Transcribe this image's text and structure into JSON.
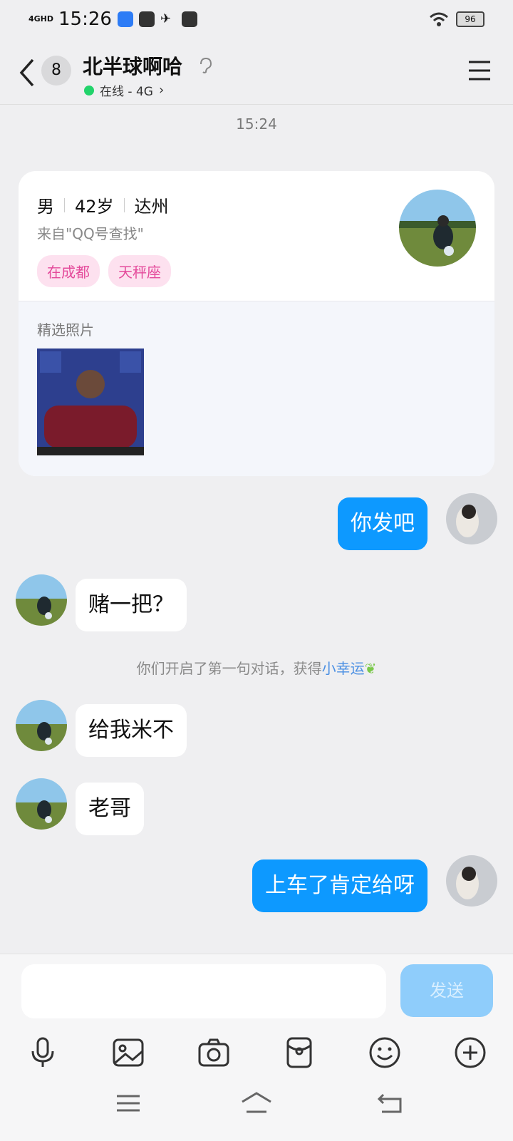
{
  "status_bar": {
    "network": "4GHD",
    "time": "15:26",
    "battery": "96"
  },
  "header": {
    "back_count": "8",
    "title": "北半球啊哈",
    "status": "在线 - 4G"
  },
  "chat_time": "15:24",
  "profile_card": {
    "gender": "男",
    "age": "42岁",
    "city": "达州",
    "source": "来自\"QQ号查找\"",
    "tags": [
      "在成都",
      "天秤座"
    ],
    "photos_label": "精选照片"
  },
  "messages": [
    {
      "side": "out",
      "text": "你发吧"
    },
    {
      "side": "in",
      "text": "赌一把？"
    },
    {
      "side": "in",
      "text": "给我米不"
    },
    {
      "side": "in",
      "text": "老哥"
    },
    {
      "side": "out",
      "text": "上车了肯定给呀"
    }
  ],
  "system_message": {
    "text": "你们开启了第一句对话，获得",
    "link": "小幸运"
  },
  "input": {
    "placeholder": "",
    "send_label": "发送"
  },
  "colors": {
    "accent": "#0d99ff",
    "online": "#22d36b",
    "tag_bg": "#fde1ef",
    "tag_text": "#e44a9b"
  },
  "icons": [
    "back-icon",
    "ear-icon",
    "menu-icon",
    "mic-icon",
    "image-icon",
    "camera-icon",
    "red-packet-icon",
    "emoji-icon",
    "plus-icon",
    "nav-menu-icon",
    "nav-home-icon",
    "nav-back-icon"
  ]
}
